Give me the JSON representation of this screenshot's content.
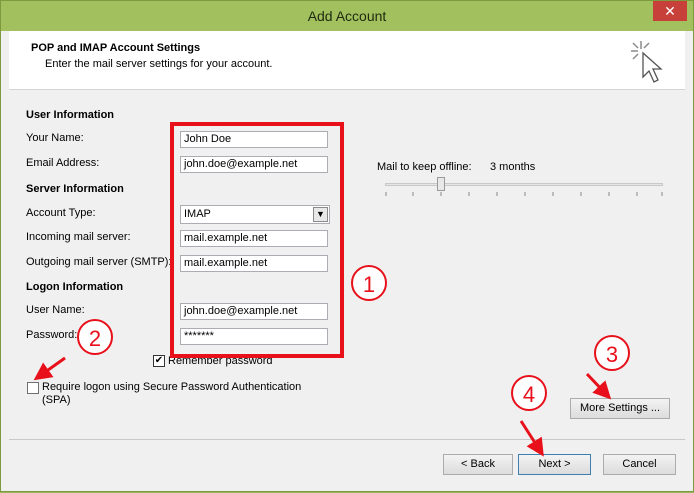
{
  "window": {
    "title": "Add Account",
    "close_glyph": "✕"
  },
  "header": {
    "title": "POP and IMAP Account Settings",
    "subtitle": "Enter the mail server settings for your account.",
    "icon": "cursor-sparkle-icon"
  },
  "user_info": {
    "heading": "User Information",
    "your_name_label": "Your Name:",
    "your_name_value": "John Doe",
    "email_label": "Email Address:",
    "email_value": "john.doe@example.net"
  },
  "server_info": {
    "heading": "Server Information",
    "account_type_label": "Account Type:",
    "account_type_value": "IMAP",
    "incoming_label": "Incoming mail server:",
    "incoming_value": "mail.example.net",
    "outgoing_label": "Outgoing mail server (SMTP):",
    "outgoing_value": "mail.example.net"
  },
  "logon_info": {
    "heading": "Logon Information",
    "username_label": "User Name:",
    "username_value": "john.doe@example.net",
    "password_label": "Password:",
    "password_value": "*******",
    "remember_label": "Remember password",
    "remember_checked": true,
    "spa_label": "Require logon using Secure Password Authentication",
    "spa_label_2": "(SPA)",
    "spa_checked": false
  },
  "offline": {
    "label": "Mail to keep offline:",
    "value": "3 months"
  },
  "annotations": {
    "badge_1": "1",
    "badge_2": "2",
    "badge_3": "3",
    "badge_4": "4",
    "color": "#e8111b"
  },
  "buttons": {
    "more_settings": "More Settings ...",
    "back": "< Back",
    "next": "Next >",
    "cancel": "Cancel"
  },
  "colors": {
    "titlebar": "#a3c05e",
    "close": "#c7403a",
    "annotation_red": "#e8111b"
  }
}
